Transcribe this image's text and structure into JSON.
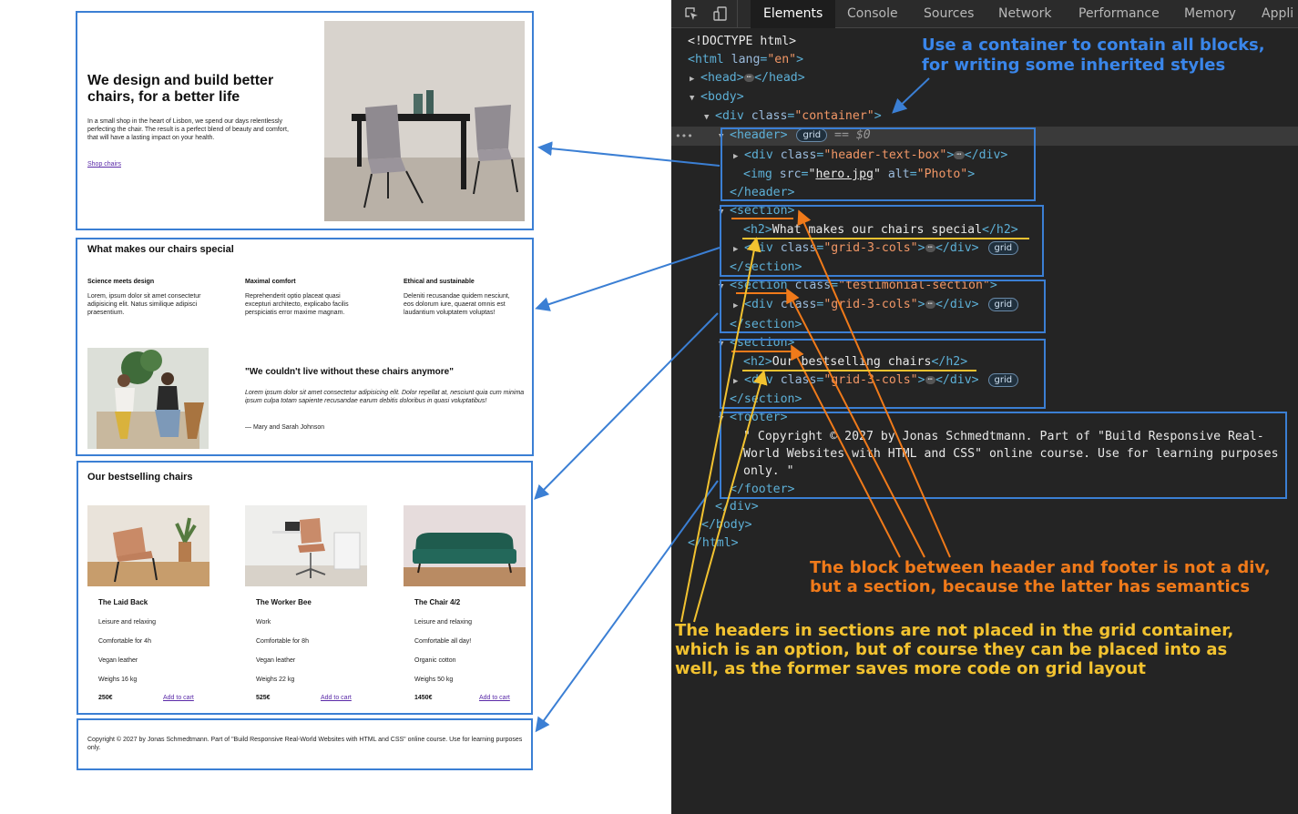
{
  "page": {
    "hero": {
      "title": "We design and build better chairs, for a better life",
      "text": "In a small shop in the heart of Lisbon, we spend our days relentlessly perfecting the chair. The result is a perfect blend of beauty and comfort, that will have a lasting impact on your health.",
      "link": "Shop chairs"
    },
    "special": {
      "title": "What makes our chairs special",
      "features": [
        {
          "title": "Science meets design",
          "text": "Lorem, ipsum dolor sit amet consectetur adipisicing elit. Natus similique adipisci praesentium."
        },
        {
          "title": "Maximal comfort",
          "text": "Reprehenderit optio placeat quasi excepturi architecto, explicabo facilis perspiciatis error maxime magnam."
        },
        {
          "title": "Ethical and sustainable",
          "text": "Deleniti recusandae quidem nesciunt, eos dolorum iure, quaerat omnis est laudantium voluptatem voluptas!"
        }
      ]
    },
    "testimonial": {
      "quote": "\"We couldn't live without these chairs anymore\"",
      "body": "Lorem ipsum dolor sit amet consectetur adipisicing elit. Dolor repellat at, nesciunt quia cum minima ipsum culpa totam sapiente recusandae earum debitis doloribus in quasi voluptatibus!",
      "author": "— Mary and Sarah Johnson"
    },
    "bestsellers": {
      "title": "Our bestselling chairs",
      "products": [
        {
          "name": "The Laid Back",
          "attrs": [
            "Leisure and relaxing",
            "Comfortable for 4h",
            "Vegan leather",
            "Weighs 16 kg"
          ],
          "price": "250€",
          "cart": "Add to cart"
        },
        {
          "name": "The Worker Bee",
          "attrs": [
            "Work",
            "Comfortable for 8h",
            "Vegan leather",
            "Weighs 22 kg"
          ],
          "price": "525€",
          "cart": "Add to cart"
        },
        {
          "name": "The Chair 4/2",
          "attrs": [
            "Leisure and relaxing",
            "Comfortable all day!",
            "Organic cotton",
            "Weighs 50 kg"
          ],
          "price": "1450€",
          "cart": "Add to cart"
        }
      ]
    },
    "footer": "Copyright © 2027 by Jonas Schmedtmann. Part of \"Build Responsive Real-World Websites with HTML and CSS\" online course. Use for learning purposes only."
  },
  "devtools": {
    "tabs": [
      "Elements",
      "Console",
      "Sources",
      "Network",
      "Performance",
      "Memory",
      "Appli"
    ],
    "active_tab": "Elements",
    "selected_suffix": "== $0",
    "gutter": "•••",
    "grid_badge": "grid",
    "ellipsis": "⋯",
    "footer_text": "\" Copyright © 2027 by Jonas Schmedtmann. Part of \"Build Responsive Real-World Websites with HTML and CSS\" online course. Use for learning purposes only. \""
  },
  "annotations": {
    "blue": "Use a container to contain all blocks,\nfor writing some inherited styles",
    "orange": "The block between header and footer is not a div,\nbut a section, because the latter has semantics",
    "yellow": "The headers in sections are not placed in the grid container,\nwhich is an option, but of course they can be placed into as\nwell, as the former saves more code on grid layout"
  },
  "colors": {
    "annotation_blue": "#3a86ea",
    "annotation_orange": "#f07a1a",
    "annotation_yellow": "#f2c230",
    "outline_blue": "#3b7fd4"
  }
}
